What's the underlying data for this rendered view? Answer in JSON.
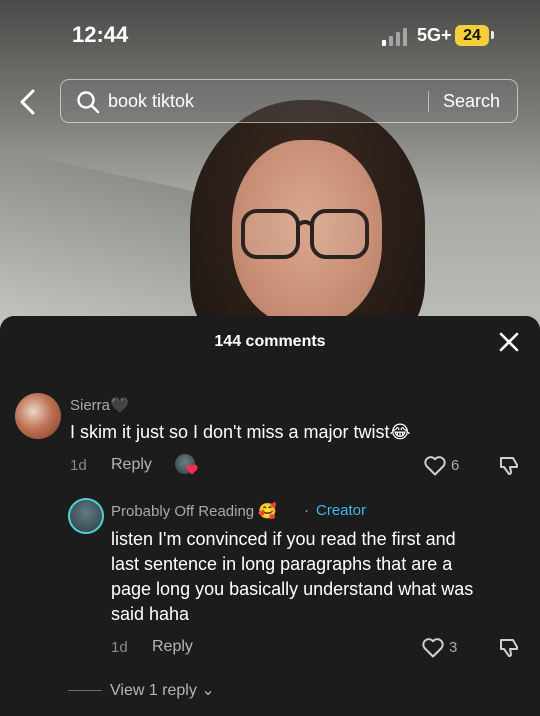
{
  "status_bar": {
    "time": "12:44",
    "network": "5G+",
    "battery": "24"
  },
  "search": {
    "query": "book tiktok",
    "button_label": "Search"
  },
  "comments": {
    "header": "144 comments",
    "items": [
      {
        "username": "Sierra🖤",
        "text": "I skim it just so I don't miss a major twist😂",
        "age": "1d",
        "reply_label": "Reply",
        "likes": "6"
      }
    ],
    "reply": {
      "username": "Probably Off Reading 🥰",
      "separator": "·",
      "badge": "Creator",
      "lines": [
        "listen I'm convinced if you read the first and",
        "last sentence in long paragraphs that are a",
        "page long you basically understand what was",
        "said haha"
      ],
      "age": "1d",
      "reply_label": "Reply",
      "likes": "3"
    },
    "view_replies": "View 1 reply"
  },
  "colors": {
    "creator": "#41b7ea",
    "battery": "#f4cf3a",
    "liked_heart": "#fe2c55"
  }
}
